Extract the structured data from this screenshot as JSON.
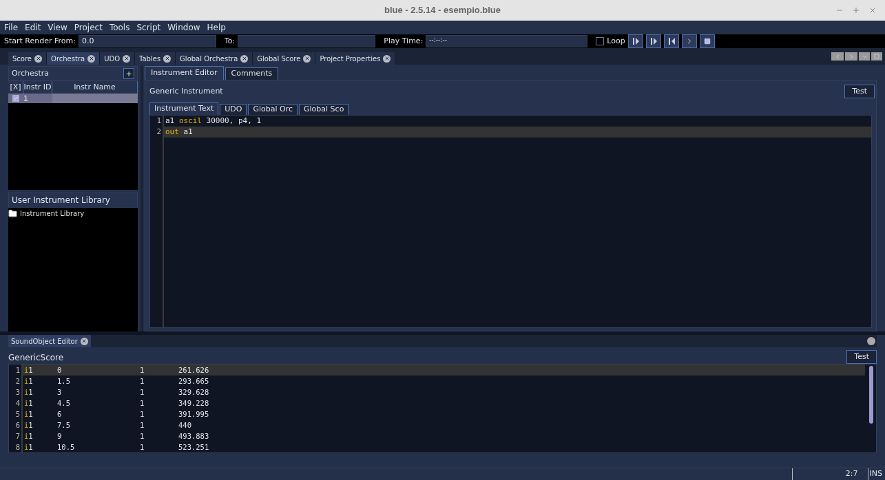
{
  "window": {
    "title": "blue - 2.5.14 - esempio.blue"
  },
  "menu": [
    "File",
    "Edit",
    "View",
    "Project",
    "Tools",
    "Script",
    "Window",
    "Help"
  ],
  "toolbar": {
    "start_label": "Start Render From:",
    "start_value": "0.0",
    "to_label": "To:",
    "play_label": "Play Time:",
    "play_value": "--:--:--",
    "loop": {
      "label": "Loop",
      "checked": false
    }
  },
  "tabs": [
    {
      "label": "Score",
      "selected": false
    },
    {
      "label": "Orchestra",
      "selected": true
    },
    {
      "label": "UDO",
      "selected": false
    },
    {
      "label": "Tables",
      "selected": false
    },
    {
      "label": "Global Orchestra",
      "selected": false
    },
    {
      "label": "Global Score",
      "selected": false
    },
    {
      "label": "Project Properties",
      "selected": false
    }
  ],
  "orchestra": {
    "title": "Orchestra",
    "add": "+",
    "columns": [
      "[X]",
      "Instr ID",
      "Instr Name"
    ],
    "rows": [
      {
        "enabled": true,
        "id": "1",
        "name": "",
        "selected": true
      }
    ]
  },
  "library": {
    "title": "User Instrument Library",
    "items": [
      {
        "label": "Instrument Library"
      }
    ]
  },
  "editor_tabs": [
    {
      "label": "Instrument Editor",
      "selected": true
    },
    {
      "label": "Comments",
      "selected": false
    }
  ],
  "instrument": {
    "title": "Generic Instrument",
    "test": "Test"
  },
  "text_tabs": [
    {
      "label": "Instrument Text",
      "selected": true
    },
    {
      "label": "UDO",
      "selected": false
    },
    {
      "label": "Global Orc",
      "selected": false
    },
    {
      "label": "Global Sco",
      "selected": false
    }
  ],
  "code": [
    {
      "number": "1",
      "current": false,
      "tokens": [
        {
          "text": "a1 ",
          "kind": "plain"
        },
        {
          "text": "oscil",
          "kind": "keyword"
        },
        {
          "text": " 30000, p4, 1",
          "kind": "plain"
        }
      ]
    },
    {
      "number": "2",
      "current": true,
      "tokens": [
        {
          "text": "out",
          "kind": "keyword"
        },
        {
          "text": " a1",
          "kind": "plain"
        }
      ]
    }
  ],
  "soundobject": {
    "tab": "SoundObject Editor",
    "title": "GenericScore",
    "test": "Test",
    "lines": [
      {
        "number": "1",
        "current": true,
        "op": "i",
        "instr": "1",
        "cols": [
          "0",
          "1",
          "261.626"
        ]
      },
      {
        "number": "2",
        "current": false,
        "op": "i",
        "instr": "1",
        "cols": [
          "1.5",
          "1",
          "293.665"
        ]
      },
      {
        "number": "3",
        "current": false,
        "op": "i",
        "instr": "1",
        "cols": [
          "3",
          "1",
          "329.628"
        ]
      },
      {
        "number": "4",
        "current": false,
        "op": "i",
        "instr": "1",
        "cols": [
          "4.5",
          "1",
          "349.228"
        ]
      },
      {
        "number": "5",
        "current": false,
        "op": "i",
        "instr": "1",
        "cols": [
          "6",
          "1",
          "391.995"
        ]
      },
      {
        "number": "6",
        "current": false,
        "op": "i",
        "instr": "1",
        "cols": [
          "7.5",
          "1",
          "440"
        ]
      },
      {
        "number": "7",
        "current": false,
        "op": "i",
        "instr": "1",
        "cols": [
          "9",
          "1",
          "493.883"
        ]
      },
      {
        "number": "8",
        "current": false,
        "op": "i",
        "instr": "1",
        "cols": [
          "10.5",
          "1",
          "523.251"
        ]
      }
    ]
  },
  "status_bar": {
    "position": "2:7",
    "mode": "INS"
  }
}
